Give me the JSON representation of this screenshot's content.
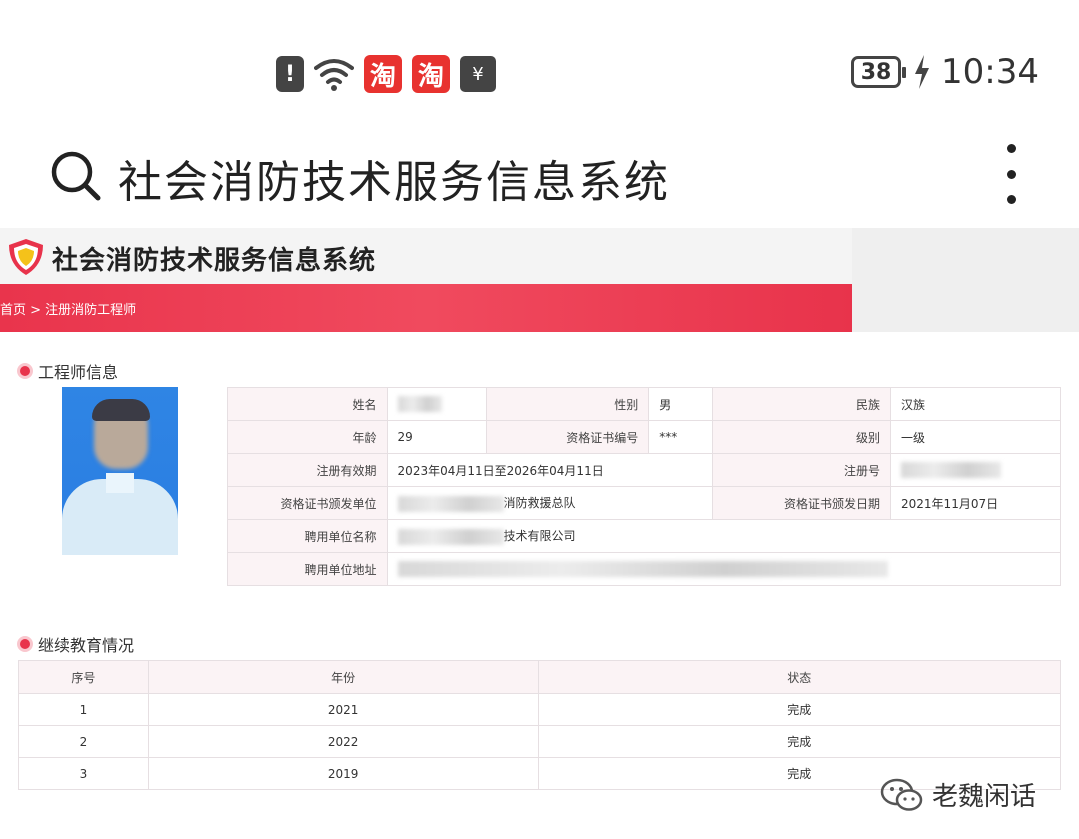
{
  "status_bar": {
    "alert_glyph": "!",
    "taobao_glyph": "淘",
    "battery": "38",
    "time": "10:34",
    "icons": [
      "alert-icon",
      "wifi-icon",
      "taobao-icon",
      "taobao-icon",
      "wallet-icon",
      "battery-icon",
      "charging-icon"
    ]
  },
  "search": {
    "query": "社会消防技术服务信息系统"
  },
  "site": {
    "title": "社会消防技术服务信息系统",
    "breadcrumb": "首页 > 注册消防工程师",
    "accent_color": "#e8334b"
  },
  "engineer": {
    "section_title": "工程师信息",
    "labels": {
      "name": "姓名",
      "gender": "性别",
      "ethnicity": "民族",
      "age": "年龄",
      "cert_no": "资格证书编号",
      "level": "级别",
      "validity": "注册有效期",
      "reg_no": "注册号",
      "issuer": "资格证书颁发单位",
      "issue_date": "资格证书颁发日期",
      "employer": "聘用单位名称",
      "address": "聘用单位地址"
    },
    "values": {
      "gender": "男",
      "ethnicity": "汉族",
      "age": "29",
      "cert_no": "***",
      "level": "一级",
      "validity": "2023年04月11日至2026年04月11日",
      "issuer_visible": "消防救援总队",
      "issue_date": "2021年11月07日",
      "employer_visible": "技术有限公司"
    }
  },
  "education": {
    "section_title": "继续教育情况",
    "headers": [
      "序号",
      "年份",
      "状态"
    ],
    "rows": [
      {
        "no": "1",
        "year": "2021",
        "status": "完成"
      },
      {
        "no": "2",
        "year": "2022",
        "status": "完成"
      },
      {
        "no": "3",
        "year": "2019",
        "status": "完成"
      }
    ]
  },
  "watermark": {
    "text": "老魏闲话"
  }
}
